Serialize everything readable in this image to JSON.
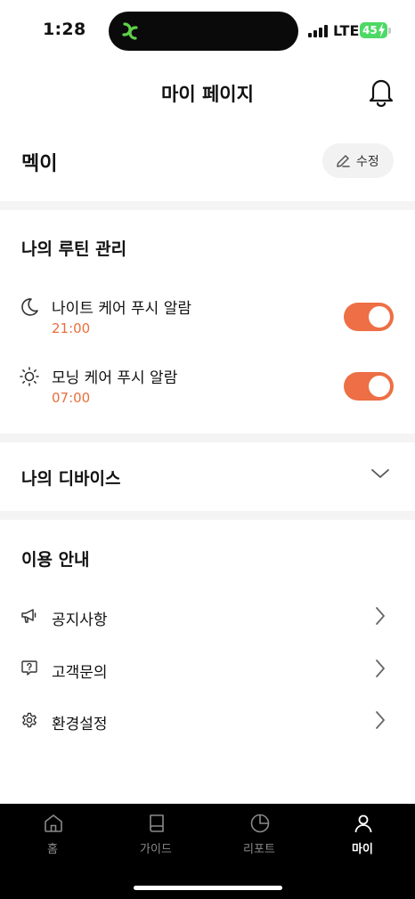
{
  "status_bar": {
    "time": "1:28",
    "network": "LTE",
    "battery": "45"
  },
  "header": {
    "title": "마이 페이지",
    "notification_icon": "bell-icon"
  },
  "profile": {
    "nickname": "멕이",
    "edit_label": "수정",
    "edit_icon": "pencil-icon"
  },
  "routine": {
    "title": "나의 루틴 관리",
    "items": [
      {
        "icon": "moon-icon",
        "label": "나이트 케어 푸시 알람",
        "time": "21:00",
        "enabled": true
      },
      {
        "icon": "sun-icon",
        "label": "모닝 케어 푸시 알람",
        "time": "07:00",
        "enabled": true
      }
    ]
  },
  "devices": {
    "title": "나의 디바이스",
    "toggle_icon": "chevron-down-icon"
  },
  "info": {
    "title": "이용 안내",
    "items": [
      {
        "icon": "megaphone-icon",
        "label": "공지사항"
      },
      {
        "icon": "question-bubble-icon",
        "label": "고객문의"
      },
      {
        "icon": "gear-icon",
        "label": "환경설정"
      }
    ]
  },
  "tabs": [
    {
      "icon": "home-icon",
      "label": "홈",
      "active": false
    },
    {
      "icon": "book-icon",
      "label": "가이드",
      "active": false
    },
    {
      "icon": "pie-chart-icon",
      "label": "리포트",
      "active": false
    },
    {
      "icon": "person-icon",
      "label": "마이",
      "active": true
    }
  ],
  "colors": {
    "accent": "#ee6e45",
    "time_text": "#e8703e",
    "battery": "#4cd964",
    "divider": "#f4f4f4",
    "tab_bar": "#000000"
  }
}
